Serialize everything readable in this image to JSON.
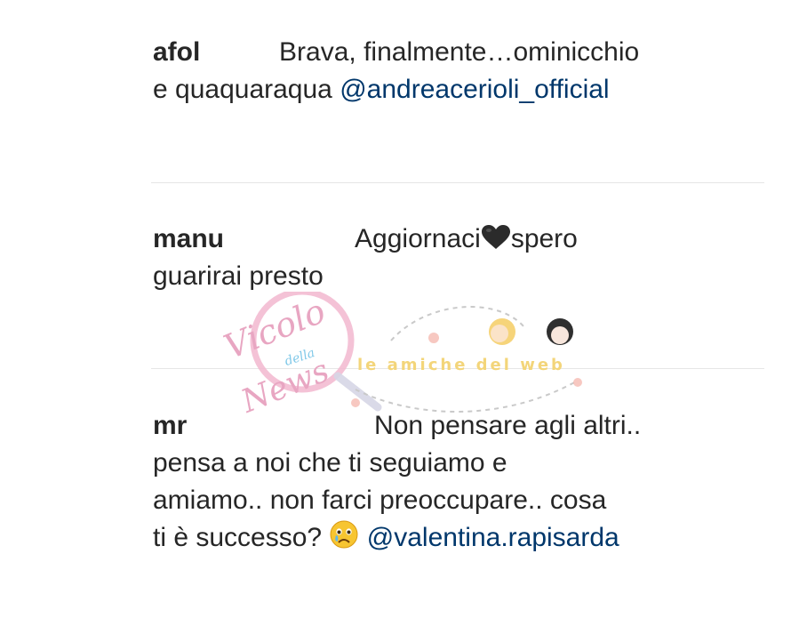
{
  "comments": [
    {
      "username": "afol",
      "line1_text": "Brava, finalmente…ominicchio",
      "line2_text": "e quaquaraqua",
      "mention": "@andreacerioli_official"
    },
    {
      "username": "manu",
      "line1_text_before": "Aggiornaci",
      "line1_text_after": "spero",
      "line2_text": "guarirai presto",
      "emoji_icon": "black-heart-icon"
    },
    {
      "username": "mr",
      "line1_text": "Non pensare agli altri..",
      "line2_text": "pensa a noi che ti seguiamo e",
      "line3_text": "amiamo.. non farci preoccupare.. cosa",
      "line4_text": "ti è successo?",
      "emoji_icon": "crying-face-icon",
      "mention": "@valentina.rapisarda"
    }
  ],
  "watermark": {
    "logo_text_1": "Vicolo",
    "logo_text_2": "della",
    "logo_text_3": "News",
    "sub_text": "le amiche del web"
  },
  "colors": {
    "text": "#262626",
    "mention": "#00376b",
    "divider": "#e6e6e6",
    "watermark_pink": "#e8a6c2",
    "watermark_yellow": "#f3d57a"
  }
}
